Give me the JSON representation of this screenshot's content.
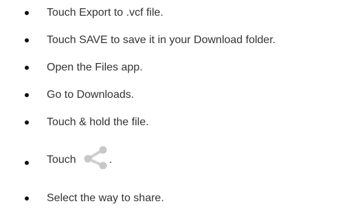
{
  "steps": [
    {
      "text": "Touch Export to .vcf file."
    },
    {
      "text": "Touch SAVE to save it in your Download folder."
    },
    {
      "text": "Open the Files app."
    },
    {
      "text": "Go to Downloads."
    },
    {
      "text": "Touch & hold the file."
    },
    {
      "text": "Touch",
      "icon": "share-icon",
      "suffix": "."
    },
    {
      "text": "Select the way to share."
    }
  ],
  "colors": {
    "text": "#333333",
    "bullet": "#111111",
    "icon": "#c8c8c8"
  }
}
